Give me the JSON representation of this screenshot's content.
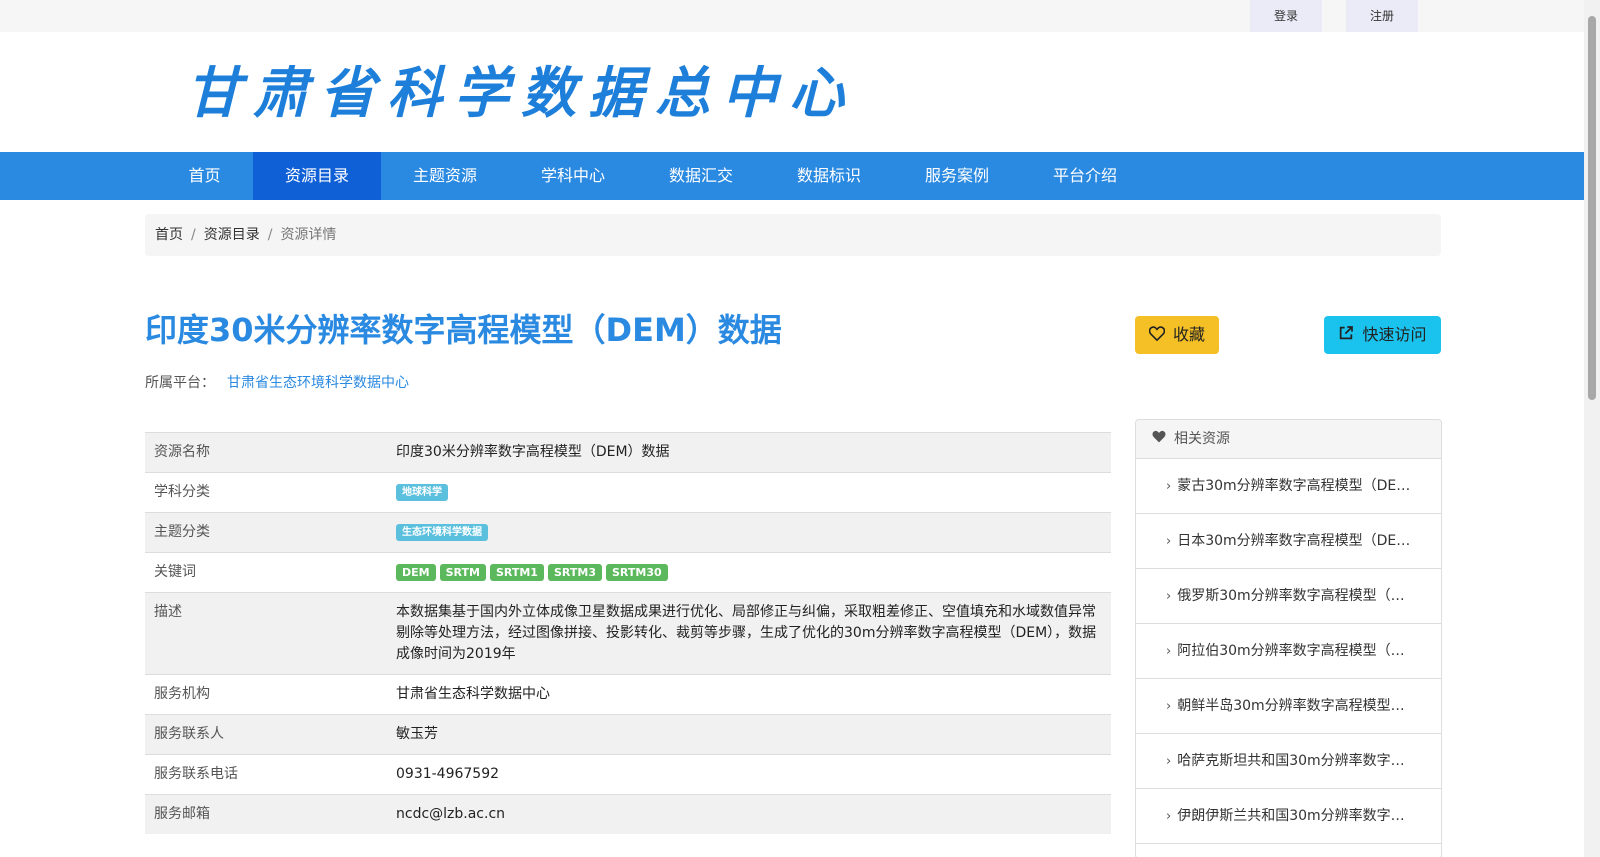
{
  "topbar": {
    "login": "登录",
    "register": "注册"
  },
  "logo": "甘肃省科学数据总中心",
  "nav": {
    "items": [
      "首页",
      "资源目录",
      "主题资源",
      "学科中心",
      "数据汇交",
      "数据标识",
      "服务案例",
      "平台介绍"
    ],
    "active": "资源目录"
  },
  "breadcrumb": [
    "首页",
    "资源目录",
    "资源详情"
  ],
  "title": "印度30米分辨率数字高程模型（DEM）数据",
  "platform": {
    "label": "所属平台：",
    "value": "甘肃省生态环境科学数据中心"
  },
  "buttons": {
    "favorite": "收藏",
    "quick_visit": "快速访问"
  },
  "details": [
    {
      "key": "资源名称",
      "value": "印度30米分辨率数字高程模型（DEM）数据"
    },
    {
      "key": "学科分类",
      "tags": [
        "地球科学"
      ]
    },
    {
      "key": "主题分类",
      "tags": [
        "生态环境科学数据"
      ]
    },
    {
      "key": "关键词",
      "tags": [
        "DEM",
        "SRTM",
        "SRTM1",
        "SRTM3",
        "SRTM30"
      ]
    },
    {
      "key": "描述",
      "value": "本数据集基于国内外立体成像卫星数据成果进行优化、局部修正与纠偏，采取粗差修正、空值填充和水域数值异常剔除等处理方法，经过图像拼接、投影转化、裁剪等步骤，生成了优化的30m分辨率数字高程模型（DEM），数据成像时间为2019年"
    },
    {
      "key": "服务机构",
      "value": "甘肃省生态科学数据中心"
    },
    {
      "key": "服务联系人",
      "value": "敏玉芳"
    },
    {
      "key": "服务联系电话",
      "value": "0931-4967592"
    },
    {
      "key": "服务邮箱",
      "value": "ncdc@lzb.ac.cn"
    }
  ],
  "related": {
    "title": "相关资源",
    "items": [
      "蒙古30m分辨率数字高程模型（DE…",
      "日本30m分辨率数字高程模型（DE…",
      "俄罗斯30m分辨率数字高程模型（…",
      "阿拉伯30m分辨率数字高程模型（…",
      "朝鲜半岛30m分辨率数字高程模型…",
      "哈萨克斯坦共和国30m分辨率数字…",
      "伊朗伊斯兰共和国30m分辨率数字…"
    ]
  },
  "colors": {
    "primary": "#2a89e0",
    "nav_active": "#0f60d6",
    "favorite": "#f5c026",
    "visit": "#19c3ee",
    "tag_info": "#5bc0de",
    "tag_success": "#5cb85c"
  }
}
